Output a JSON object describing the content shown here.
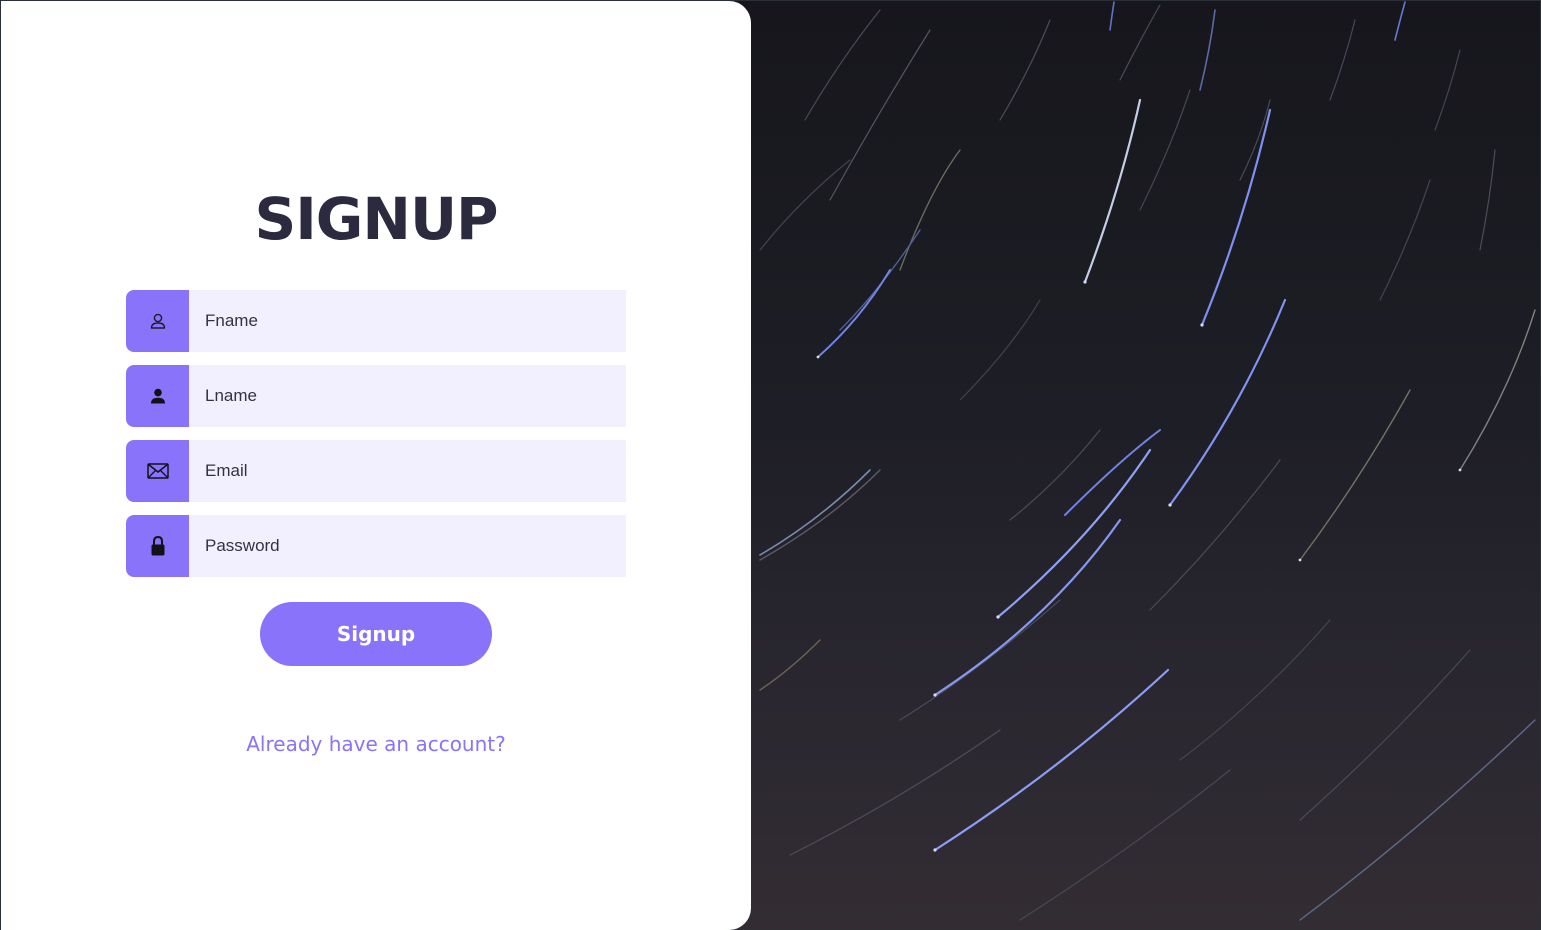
{
  "signup": {
    "title": "SIGNUP",
    "fields": [
      {
        "placeholder": "Fname",
        "icon": "user-outline-icon"
      },
      {
        "placeholder": "Lname",
        "icon": "user-solid-icon"
      },
      {
        "placeholder": "Email",
        "icon": "envelope-icon"
      },
      {
        "placeholder": "Password",
        "icon": "lock-icon"
      }
    ],
    "submit_label": "Signup",
    "login_link": "Already have an account?"
  },
  "colors": {
    "accent": "#8a73fb",
    "field_background": "#f2f0fe",
    "title": "#2b2a3f",
    "panel": "#ffffff"
  },
  "background": {
    "description_icon": "star-trails-image"
  }
}
